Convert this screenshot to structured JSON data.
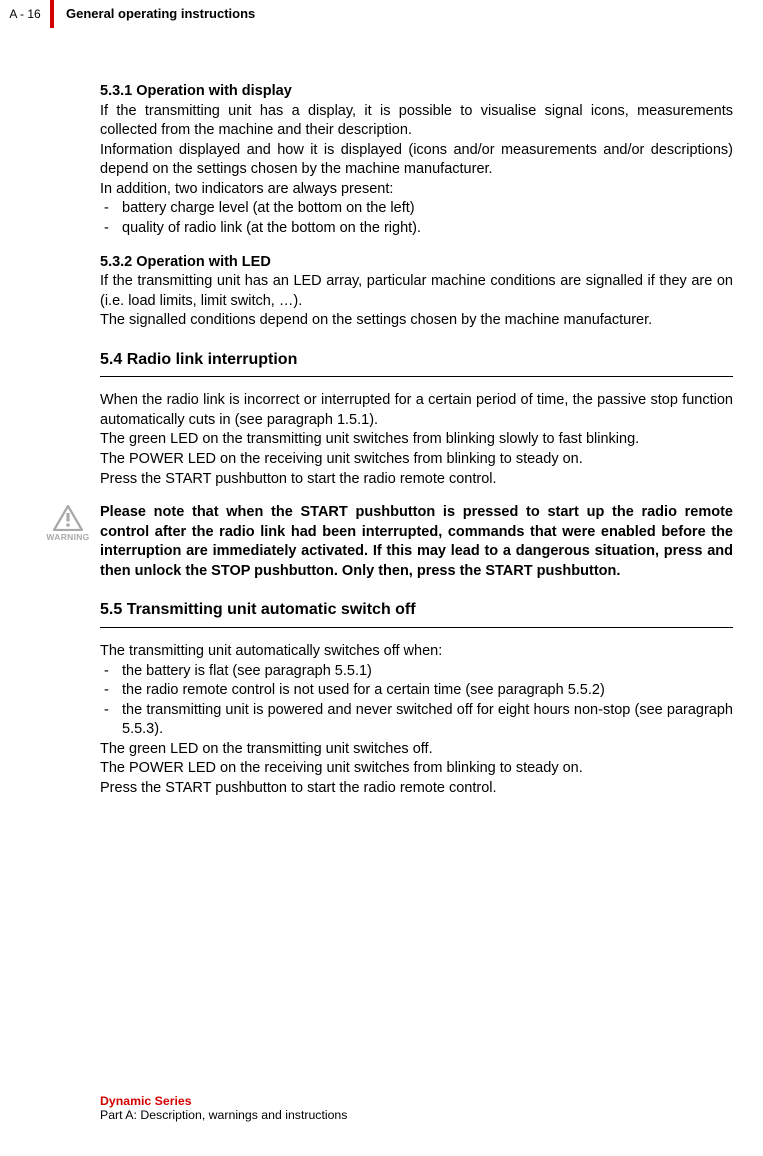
{
  "header": {
    "page_ref": "A - 16",
    "title": "General operating instructions"
  },
  "s531": {
    "heading": "5.3.1   Operation with display",
    "p1": "If the transmitting unit has a display, it is possible to visualise signal icons, measurements collected from the machine and their description.",
    "p2": "Information displayed and how it is displayed (icons and/or measurements and/or descriptions) depend on the settings chosen by the machine manufacturer.",
    "p3": "In addition, two indicators are always present:",
    "li1": "battery charge level (at the bottom on the left)",
    "li2": "quality of radio link (at the bottom on the right)."
  },
  "s532": {
    "heading": "5.3.2   Operation with LED",
    "p1": "If the transmitting unit has an LED array, particular machine conditions are signalled if they are on (i.e. load limits, limit switch, …).",
    "p2": "The signalled conditions depend on the settings chosen by the machine manufacturer."
  },
  "s54": {
    "heading": "5.4   Radio link interruption",
    "p1": "When the radio link is incorrect or interrupted for a certain period of time, the passive stop function automatically cuts in (see paragraph 1.5.1).",
    "p2": "The green LED on the transmitting unit switches from blinking slowly to fast blinking.",
    "p3": "The POWER LED on the receiving unit switches from blinking to steady on.",
    "p4": "Press the START pushbutton to start the radio remote control."
  },
  "warning": {
    "label": "WARNING",
    "text": "Please note that when the START pushbutton is pressed to start up the radio remote control after the radio link had been interrupted, commands that were enabled before the interruption are immediately activated. If this may lead to a dangerous situation, press and then unlock the STOP pushbutton. Only then, press the START pushbutton."
  },
  "s55": {
    "heading": "5.5   Transmitting unit automatic switch off",
    "p1": "The transmitting unit automatically switches off when:",
    "li1": "the battery is flat (see paragraph 5.5.1)",
    "li2": "the radio remote control is not used for a certain time (see paragraph 5.5.2)",
    "li3": "the transmitting unit is powered and never switched off for eight hours non-stop (see paragraph 5.5.3).",
    "p2": "The green LED on the transmitting unit switches off.",
    "p3": "The POWER LED on the receiving unit switches from blinking to steady on.",
    "p4": "Press the START pushbutton to start the radio remote control."
  },
  "footer": {
    "series": "Dynamic Series",
    "part": "Part A: Description, warnings and instructions"
  }
}
